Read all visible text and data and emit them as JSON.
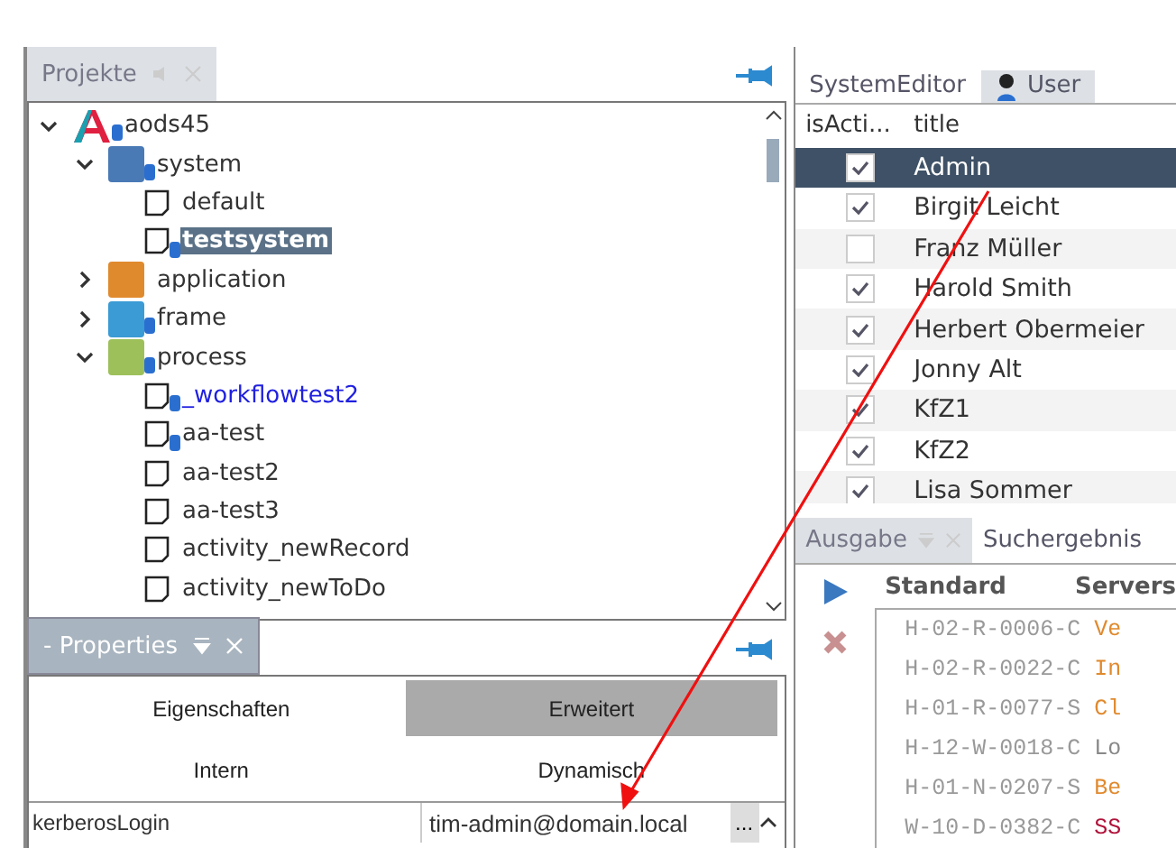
{
  "projects_panel": {
    "tab": "Projekte",
    "tree": [
      {
        "label": "aods45",
        "kind": "logo",
        "badge": true,
        "selected": false,
        "linked": false,
        "expanded": true,
        "children": [
          {
            "label": "system",
            "kind": "folder",
            "color": "#4a7ab5",
            "badge": true,
            "selected": false,
            "linked": false,
            "expanded": true,
            "children": [
              {
                "label": "default",
                "kind": "file",
                "badge": false,
                "selected": false,
                "linked": false
              },
              {
                "label": "testsystem",
                "kind": "file",
                "badge": true,
                "selected": true,
                "linked": false
              }
            ]
          },
          {
            "label": "application",
            "kind": "folder",
            "color": "#e08a2e",
            "badge": false,
            "selected": false,
            "linked": false,
            "expanded": false
          },
          {
            "label": "frame",
            "kind": "folder",
            "color": "#3a9bd5",
            "badge": true,
            "selected": false,
            "linked": false,
            "expanded": false
          },
          {
            "label": "process",
            "kind": "folder",
            "color": "#9dc05a",
            "badge": true,
            "selected": false,
            "linked": false,
            "expanded": true,
            "children": [
              {
                "label": "_workflowtest2",
                "kind": "file",
                "badge": true,
                "selected": false,
                "linked": true
              },
              {
                "label": "aa-test",
                "kind": "file",
                "badge": true,
                "selected": false,
                "linked": false
              },
              {
                "label": "aa-test2",
                "kind": "file",
                "badge": false,
                "selected": false,
                "linked": false
              },
              {
                "label": "aa-test3",
                "kind": "file",
                "badge": false,
                "selected": false,
                "linked": false
              },
              {
                "label": "activity_newRecord",
                "kind": "file",
                "badge": false,
                "selected": false,
                "linked": false
              },
              {
                "label": "activity_newToDo",
                "kind": "file",
                "badge": false,
                "selected": false,
                "linked": false
              }
            ]
          }
        ]
      }
    ]
  },
  "properties_panel": {
    "tab": "- Properties",
    "tabs": [
      {
        "label": "Eigenschaften",
        "selected": false
      },
      {
        "label": "Erweitert",
        "selected": true
      },
      {
        "label": "Intern",
        "selected": false
      },
      {
        "label": "Dynamisch",
        "selected": false
      }
    ],
    "row": {
      "name": "kerberosLogin",
      "value": "tim-admin@domain.local",
      "button": "..."
    }
  },
  "editor_tabs": [
    {
      "label": "SystemEditor",
      "selected": false,
      "icon": false
    },
    {
      "label": "User",
      "selected": true,
      "icon": true
    }
  ],
  "user_table": {
    "columns": [
      "isActi...",
      "title"
    ],
    "rows": [
      {
        "active": true,
        "title": "Admin",
        "selected": true
      },
      {
        "active": true,
        "title": "Birgit Leicht",
        "selected": false
      },
      {
        "active": false,
        "title": "Franz Müller",
        "selected": false
      },
      {
        "active": true,
        "title": "Harold Smith",
        "selected": false
      },
      {
        "active": true,
        "title": "Herbert Obermeier",
        "selected": false
      },
      {
        "active": true,
        "title": "Jonny Alt",
        "selected": false
      },
      {
        "active": true,
        "title": "KfZ1",
        "selected": false
      },
      {
        "active": true,
        "title": "KfZ2",
        "selected": false
      },
      {
        "active": true,
        "title": "Lisa Sommer",
        "selected": false
      }
    ]
  },
  "output_tabs": [
    {
      "label": "Ausgabe",
      "selected": true
    },
    {
      "label": "Suchergebnis",
      "selected": false
    }
  ],
  "output": {
    "columns": [
      "Standard",
      "Servers"
    ],
    "lines": [
      {
        "code": "H-02-R-0006-C",
        "message": "Ve",
        "color": "#e08a2e"
      },
      {
        "code": "H-02-R-0022-C",
        "message": "In",
        "color": "#e08a2e"
      },
      {
        "code": "H-01-R-0077-S",
        "message": "Cl",
        "color": "#e08a2e"
      },
      {
        "code": "H-12-W-0018-C",
        "message": "Lo",
        "color": "#888888"
      },
      {
        "code": "H-01-N-0207-S",
        "message": "Be",
        "color": "#e08a2e"
      },
      {
        "code": "W-10-D-0382-C",
        "message": "SS",
        "color": "#b0123a"
      }
    ]
  }
}
